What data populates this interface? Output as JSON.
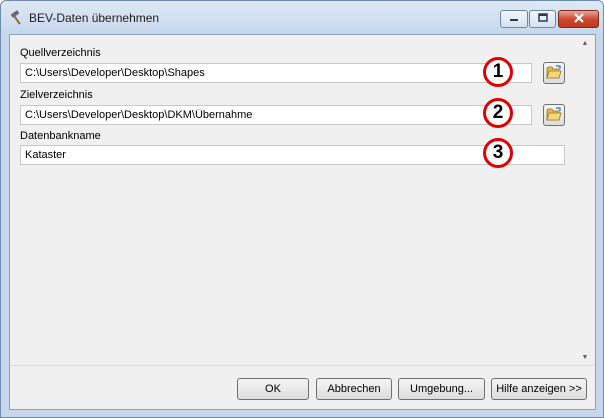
{
  "window": {
    "title": "BEV-Daten übernehmen",
    "title_icon": "hammer-icon",
    "controls": [
      "minimize-icon",
      "maximize-icon",
      "close-icon"
    ]
  },
  "form": {
    "source": {
      "label": "Quellverzeichnis",
      "value": "C:\\Users\\Developer\\Desktop\\Shapes",
      "browse_icon": "open-folder-icon",
      "callout": "1"
    },
    "target": {
      "label": "Zielverzeichnis",
      "value": "C:\\Users\\Developer\\Desktop\\DKM\\Übernahme",
      "browse_icon": "open-folder-icon",
      "callout": "2"
    },
    "database": {
      "label": "Datenbankname",
      "value": "Kataster",
      "callout": "3"
    }
  },
  "buttons": {
    "ok": "OK",
    "cancel": "Abbrechen",
    "environment": "Umgebung...",
    "help": "Hilfe anzeigen >>"
  },
  "colors": {
    "callout_border": "#e00000",
    "window_frame": "#c6d7ec",
    "close_button": "#c9462c"
  }
}
